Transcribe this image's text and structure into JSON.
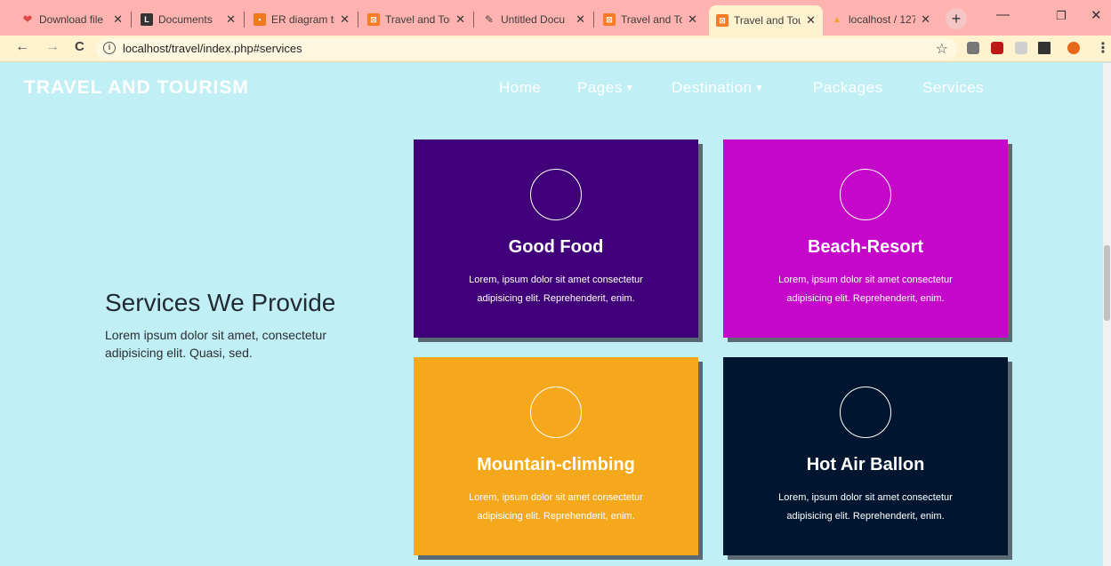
{
  "browser": {
    "tabs": [
      {
        "title": "Download file",
        "icon": "heart-icon",
        "color": "#e04848"
      },
      {
        "title": "Documents",
        "icon": "document-icon",
        "color": "#333333"
      },
      {
        "title": "ER diagram tra",
        "icon": "diagram-icon",
        "color": "#f07a1a"
      },
      {
        "title": "Travel and Tou",
        "icon": "xampp-icon",
        "color": "#fb7a24"
      },
      {
        "title": "Untitled Docu",
        "icon": "doc-icon",
        "color": "#333333"
      },
      {
        "title": "Travel and Tou",
        "icon": "xampp-icon",
        "color": "#fb7a24"
      },
      {
        "title": "Travel and Tou",
        "icon": "xampp-icon",
        "color": "#fb7a24"
      },
      {
        "title": "localhost / 127",
        "icon": "phpmyadmin-icon",
        "color": "#f2a12c"
      }
    ],
    "active_tab_index": 6,
    "url": "localhost/travel/index.php#services"
  },
  "site": {
    "brand": "TRAVEL AND TOURISM",
    "nav": {
      "home": "Home",
      "pages": "Pages",
      "destination": "Destination",
      "packages": "Packages",
      "services": "Services"
    }
  },
  "services": {
    "title": "Services We Provide",
    "description": "Lorem ipsum dolor sit amet, consectetur adipisicing elit. Quasi, sed.",
    "cards": [
      {
        "title": "Good Food",
        "text": "Lorem, ipsum dolor sit amet consectetur adipisicing elit. Reprehenderit, enim.",
        "color": "#3f0079"
      },
      {
        "title": "Beach-Resort",
        "text": "Lorem, ipsum dolor sit amet consectetur adipisicing elit. Reprehenderit, enim.",
        "color": "#c407c8"
      },
      {
        "title": "Mountain-climbing",
        "text": "Lorem, ipsum dolor sit amet consectetur adipisicing elit. Reprehenderit, enim.",
        "color": "#f6a81c"
      },
      {
        "title": "Hot Air Ballon",
        "text": "Lorem, ipsum dolor sit amet consectetur adipisicing elit. Reprehenderit, enim.",
        "color": "#001630"
      }
    ]
  }
}
